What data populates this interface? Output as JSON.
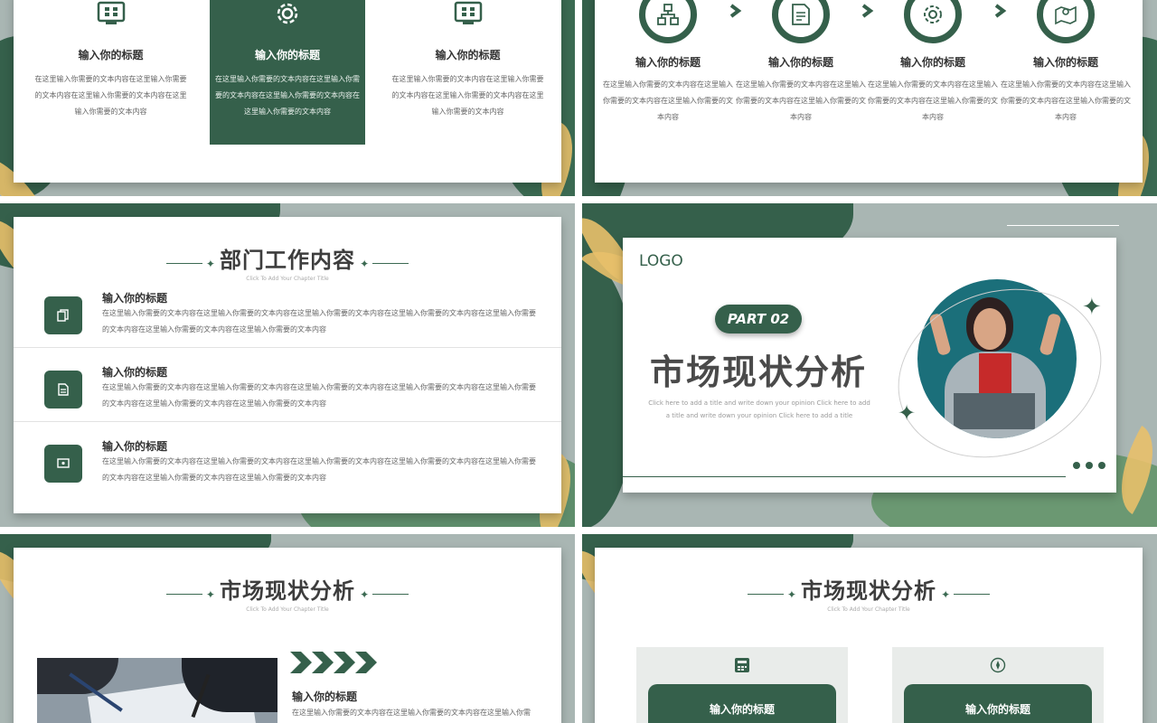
{
  "colors": {
    "primary": "#35604b",
    "accent": "#e8c06a",
    "muted": "#a9b6b3"
  },
  "slide1": {
    "cards": [
      {
        "icon": "dashboard-icon",
        "title": "输入你的标题",
        "text": "在这里输入你需要的文本内容在这里输入你需要的文本内容在这里输入你需要的文本内容在这里输入你需要的文本内容"
      },
      {
        "icon": "gear-icon",
        "title": "输入你的标题",
        "text": "在这里输入你需要的文本内容在这里输入你需要的文本内容在这里输入你需要的文本内容在这里输入你需要的文本内容"
      },
      {
        "icon": "dashboard-icon",
        "title": "输入你的标题",
        "text": "在这里输入你需要的文本内容在这里输入你需要的文本内容在这里输入你需要的文本内容在这里输入你需要的文本内容"
      }
    ]
  },
  "slide2": {
    "steps": [
      {
        "icon": "hierarchy-icon",
        "title": "输入你的标题",
        "text": "在这里输入你需要的文本内容在这里输入你需要的文本内容在这里输入你需要的文本内容"
      },
      {
        "icon": "document-icon",
        "title": "输入你的标题",
        "text": "在这里输入你需要的文本内容在这里输入你需要的文本内容在这里输入你需要的文本内容"
      },
      {
        "icon": "gear-icon",
        "title": "输入你的标题",
        "text": "在这里输入你需要的文本内容在这里输入你需要的文本内容在这里输入你需要的文本内容"
      },
      {
        "icon": "map-pin-icon",
        "title": "输入你的标题",
        "text": "在这里输入你需要的文本内容在这里输入你需要的文本内容在这里输入你需要的文本内容"
      }
    ]
  },
  "slide3": {
    "heading": "部门工作内容",
    "subheading": "Click To Add Your Chapter Title",
    "rows": [
      {
        "icon": "copy-icon",
        "title": "输入你的标题",
        "text": "在这里输入你需要的文本内容在这里输入你需要的文本内容在这里输入你需要的文本内容在这里输入你需要的文本内容在这里输入你需要的文本内容在这里输入你需要的文本内容在这里输入你需要的文本内容"
      },
      {
        "icon": "file-icon",
        "title": "输入你的标题",
        "text": "在这里输入你需要的文本内容在这里输入你需要的文本内容在这里输入你需要的文本内容在这里输入你需要的文本内容在这里输入你需要的文本内容在这里输入你需要的文本内容在这里输入你需要的文本内容"
      },
      {
        "icon": "monitor-icon",
        "title": "输入你的标题",
        "text": "在这里输入你需要的文本内容在这里输入你需要的文本内容在这里输入你需要的文本内容在这里输入你需要的文本内容在这里输入你需要的文本内容在这里输入你需要的文本内容在这里输入你需要的文本内容"
      }
    ]
  },
  "slide4": {
    "logo": "LOGO",
    "part": "PART 02",
    "title": "市场现状分析",
    "desc": "Click here to add a title and write down your opinion Click here to add a title and write down your opinion Click here to add a title"
  },
  "slide5": {
    "heading": "市场现状分析",
    "subheading": "Click To Add Your Chapter Title",
    "item_title": "输入你的标题",
    "item_text": "在这里输入你需要的文本内容在这里输入你需要的文本内容在这里输入你需"
  },
  "slide6": {
    "heading": "市场现状分析",
    "subheading": "Click To Add Your Chapter Title",
    "boxes": [
      {
        "icon": "calculator-icon",
        "title": "输入你的标题"
      },
      {
        "icon": "compass-icon",
        "title": "输入你的标题"
      }
    ]
  }
}
